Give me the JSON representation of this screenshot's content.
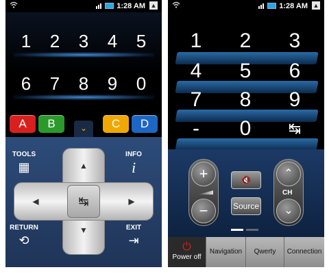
{
  "status_bar": {
    "time": "1:28 AM"
  },
  "left": {
    "keypad_row1": [
      "1",
      "2",
      "3",
      "4",
      "5"
    ],
    "keypad_row2": [
      "6",
      "7",
      "8",
      "9",
      "0"
    ],
    "color_buttons": [
      {
        "label": "A",
        "color": "#d9201e"
      },
      {
        "label": "B",
        "color": "#2a9a2a"
      },
      {
        "label": "C",
        "color": "#f0a800"
      },
      {
        "label": "D",
        "color": "#1e66c4"
      }
    ],
    "tools_label": "TOOLS",
    "info_label": "INFO",
    "return_label": "RETURN",
    "exit_label": "EXIT"
  },
  "right": {
    "keypad": [
      "1",
      "2",
      "3",
      "4",
      "5",
      "6",
      "7",
      "8",
      "9",
      "-",
      "0"
    ],
    "source_label": "Source",
    "ch_label": "CH",
    "tabs": {
      "power_off": "Power off",
      "navigation": "Navigation",
      "qwerty": "Qwerty",
      "connection": "Connection"
    }
  },
  "icons": [
    "wifi-icon",
    "signal-icon",
    "battery-icon",
    "usb-icon",
    "tools-icon",
    "info-icon",
    "return-icon",
    "exit-icon",
    "input-source-icon",
    "mute-icon",
    "power-icon"
  ],
  "colors": {
    "accent_blue": "#2f76b8",
    "power_red": "#e21c1c",
    "tab_bar_gray": "#a8a8a8"
  }
}
